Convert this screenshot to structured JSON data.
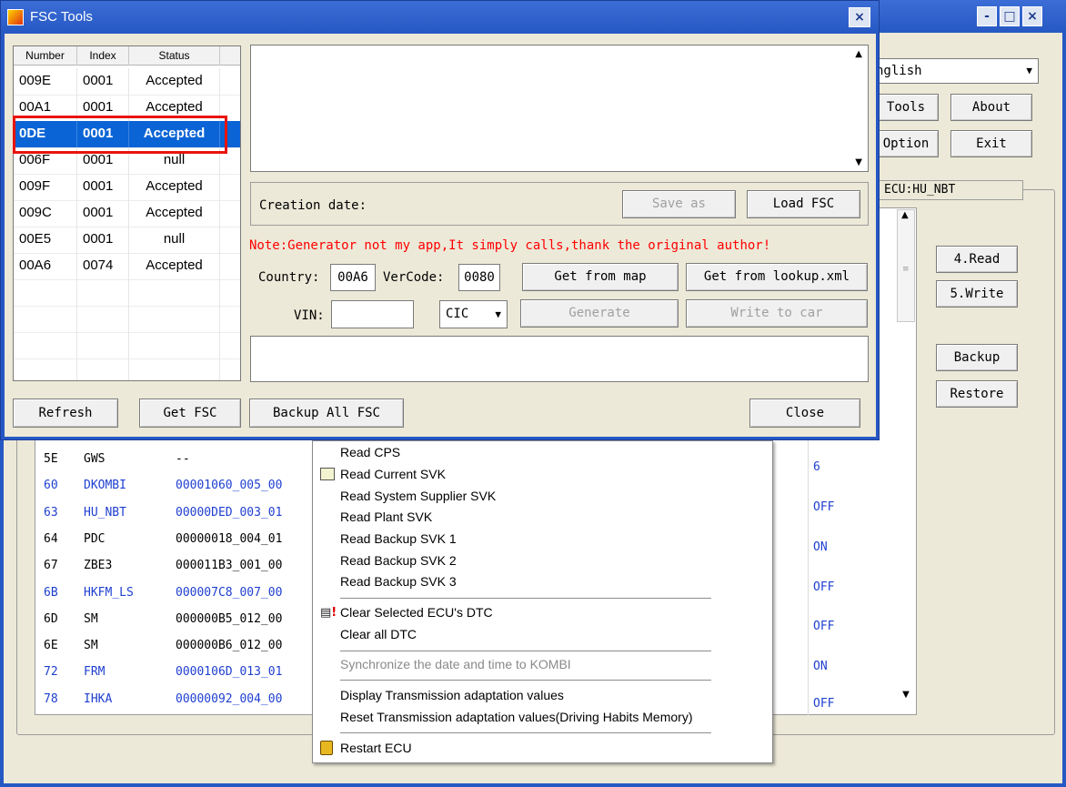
{
  "main_window": {
    "language_value": "English",
    "language_visible": "nglish",
    "buttons": {
      "tools": "Tools",
      "about": "About",
      "option": "Option",
      "exit": "Exit"
    },
    "ecu_group_label": "ECU:HU_NBT",
    "side_buttons": {
      "read": "4.Read",
      "write": "5.Write",
      "backup": "Backup",
      "restore": "Restore"
    },
    "ecu_rows": [
      {
        "addr": "5E",
        "name": "GWS",
        "svk": "--",
        "color": "#000000"
      },
      {
        "addr": "60",
        "name": "DKOMBI",
        "svk": "00001060_005_00",
        "color": "#1f3fcf"
      },
      {
        "addr": "63",
        "name": "HU_NBT",
        "svk": "00000DED_003_01",
        "color": "#1f3fcf"
      },
      {
        "addr": "64",
        "name": "PDC",
        "svk": "00000018_004_01",
        "color": "#000000"
      },
      {
        "addr": "67",
        "name": "ZBE3",
        "svk": "000011B3_001_00",
        "color": "#000000"
      },
      {
        "addr": "6B",
        "name": "HKFM_LS",
        "svk": "000007C8_007_00",
        "color": "#1f3fcf"
      },
      {
        "addr": "6D",
        "name": "SM",
        "svk": "000000B5_012_00",
        "color": "#000000"
      },
      {
        "addr": "6E",
        "name": "SM",
        "svk": "000000B6_012_00",
        "color": "#000000"
      },
      {
        "addr": "72",
        "name": "FRM",
        "svk": "0000106D_013_01",
        "color": "#1f3fcf"
      },
      {
        "addr": "78",
        "name": "IHKA",
        "svk": "00000092_004_00",
        "color": "#1f3fcf"
      }
    ],
    "right_values": [
      "6",
      "OFF",
      "ON",
      "OFF",
      "OFF",
      "ON",
      "OFF"
    ]
  },
  "context_menu": {
    "items": [
      "Read CPS",
      "Read Current SVK",
      "Read System Supplier SVK",
      "Read Plant SVK",
      "Read Backup SVK 1",
      "Read Backup SVK 2",
      "Read Backup SVK 3",
      "Clear Selected ECU's DTC",
      "Clear all DTC",
      "Synchronize the date and time to KOMBI",
      "Display Transmission adaptation values",
      "Reset Transmission adaptation values(Driving Habits Memory)",
      "Restart ECU"
    ]
  },
  "fsc_dialog": {
    "title": "FSC Tools",
    "columns": [
      "Number",
      "Index",
      "Status"
    ],
    "rows": [
      {
        "number": "009E",
        "index": "0001",
        "status": "Accepted"
      },
      {
        "number": "00A1",
        "index": "0001",
        "status": "Accepted"
      },
      {
        "number": "00DE",
        "index": "0001",
        "status": "Accepted"
      },
      {
        "number": "006F",
        "index": "0001",
        "status": "null"
      },
      {
        "number": "009F",
        "index": "0001",
        "status": "Accepted"
      },
      {
        "number": "009C",
        "index": "0001",
        "status": "Accepted"
      },
      {
        "number": "00E5",
        "index": "0001",
        "status": "null"
      },
      {
        "number": "00A6",
        "index": "0074",
        "status": "Accepted"
      }
    ],
    "selected_number_visible": "0DE",
    "creation_date_label": "Creation date:",
    "save_as": "Save as",
    "load_fsc": "Load FSC",
    "note": "Note:Generator not my app,It simply calls,thank the original author!",
    "country_label": "Country:",
    "country_value": "00A6",
    "vercode_label": "VerCode:",
    "vercode_value": "0080",
    "get_from_map": "Get from map",
    "get_from_lookup": "Get from lookup.xml",
    "vin_label": "VIN:",
    "vin_value": "",
    "unit_value": "CIC",
    "generate": "Generate",
    "write_to_car": "Write to car",
    "refresh": "Refresh",
    "get_fsc": "Get FSC",
    "backup_all": "Backup All FSC",
    "close": "Close"
  },
  "colors": {
    "titlebar": "#2f62cf",
    "selection": "#0a64d6",
    "highlight_box": "#e8140c",
    "note_red": "#ff0000",
    "link_blue": "#1f3fcf"
  }
}
